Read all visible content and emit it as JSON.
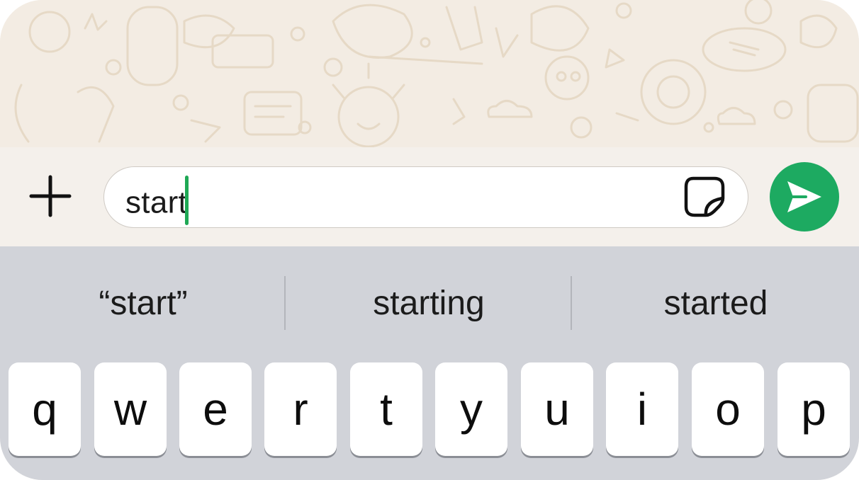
{
  "composer": {
    "input_text": "start",
    "attach_icon": "plus-icon",
    "sticker_icon": "sticker-icon",
    "send_icon": "send-icon",
    "accent_color": "#1daa61"
  },
  "keyboard": {
    "suggestions": [
      {
        "label": "“start”"
      },
      {
        "label": "starting"
      },
      {
        "label": "started"
      }
    ],
    "row1": [
      "q",
      "w",
      "e",
      "r",
      "t",
      "y",
      "u",
      "i",
      "o",
      "p"
    ]
  }
}
